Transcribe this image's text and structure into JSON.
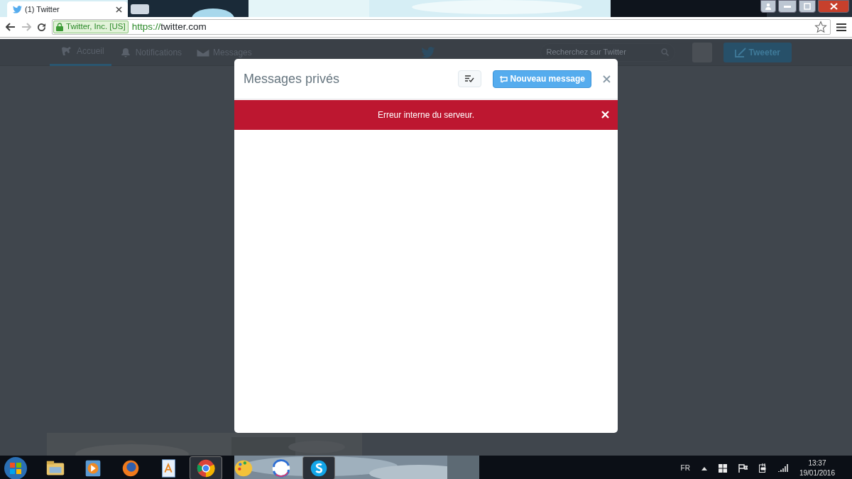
{
  "browser": {
    "tab": {
      "title": "(1) Twitter"
    },
    "identity": "Twitter, Inc. [US]",
    "url_scheme": "https://",
    "url_host": "twitter.com"
  },
  "nav": {
    "items": [
      {
        "label": "Accueil",
        "selected": true
      },
      {
        "label": "Notifications",
        "selected": false
      },
      {
        "label": "Messages",
        "selected": false
      }
    ],
    "search": {
      "placeholder": "Recherchez sur Twitter"
    },
    "tweet_button": "Tweeter"
  },
  "modal": {
    "title": "Messages privés",
    "new_message_button": "Nouveau message",
    "error": "Erreur interne du serveur."
  },
  "taskbar": {
    "apps": [
      {
        "active": false
      },
      {
        "active": false
      },
      {
        "active": false
      },
      {
        "active": false
      },
      {
        "active": true
      },
      {
        "active": false
      },
      {
        "active": false
      },
      {
        "active": true
      }
    ],
    "language": "FR",
    "time": "13:37",
    "date": "19/01/2016"
  }
}
